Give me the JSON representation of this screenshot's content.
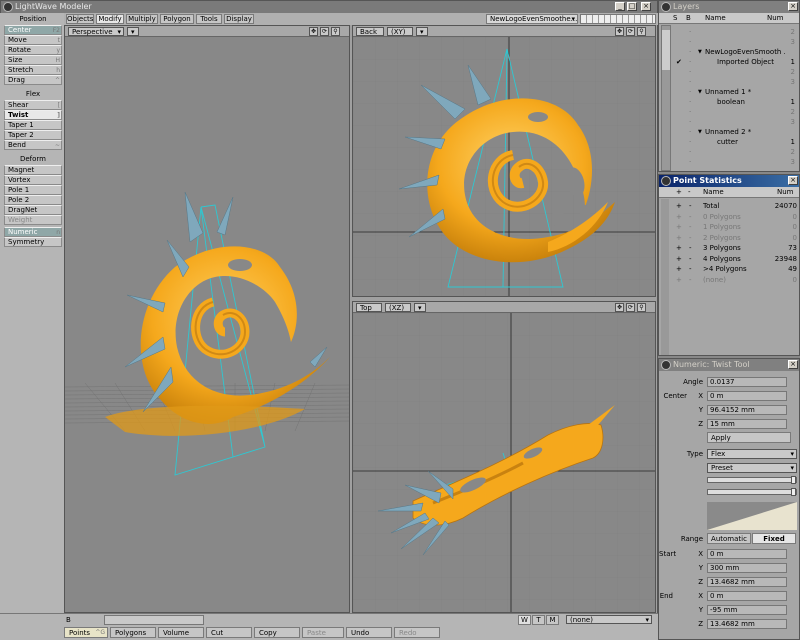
{
  "app": {
    "title": "LightWave Modeler"
  },
  "tabs": [
    "Objects",
    "Modify",
    "Multiply",
    "Polygon",
    "Tools",
    "Display"
  ],
  "object_dropdown": "NewLogoEvenSmoothe...",
  "left": {
    "position_header": "Position",
    "position_items": [
      {
        "label": "Center",
        "key": "F2"
      },
      {
        "label": "Move",
        "key": "t"
      },
      {
        "label": "Rotate",
        "key": "y"
      },
      {
        "label": "Size",
        "key": "H"
      },
      {
        "label": "Stretch",
        "key": "h"
      },
      {
        "label": "Drag",
        "key": "^"
      }
    ],
    "flex_header": "Flex",
    "flex_items": [
      {
        "label": "Shear",
        "key": "["
      },
      {
        "label": "Twist",
        "key": "]"
      },
      {
        "label": "Taper 1",
        "key": ""
      },
      {
        "label": "Taper 2",
        "key": ""
      },
      {
        "label": "Bend",
        "key": "~"
      }
    ],
    "deform_header": "Deform",
    "deform_items": [
      {
        "label": "Magnet",
        "key": ""
      },
      {
        "label": "Vortex",
        "key": ""
      },
      {
        "label": "Pole 1",
        "key": ""
      },
      {
        "label": "Pole 2",
        "key": ""
      },
      {
        "label": "DragNet",
        "key": ""
      }
    ],
    "weight": "Weight",
    "numeric": {
      "label": "Numeric",
      "key": "n"
    },
    "symmetry": "Symmetry"
  },
  "viewports": {
    "perspective": "Perspective",
    "back": "Back",
    "back_axes": "(XY)",
    "top": "Top",
    "top_axes": "(XZ)"
  },
  "layers": {
    "title": "Layers",
    "cols": [
      "S",
      "B",
      "Name",
      "Num"
    ],
    "rows": [
      {
        "name": "",
        "num": "2",
        "indent": 0
      },
      {
        "name": "",
        "num": "3",
        "indent": 0
      },
      {
        "name": "NewLogoEvenSmooth ...",
        "num": "",
        "indent": 1
      },
      {
        "name": "Imported Object",
        "num": "1",
        "indent": 2,
        "check": "✔"
      },
      {
        "name": "",
        "num": "2",
        "indent": 0
      },
      {
        "name": "",
        "num": "3",
        "indent": 0
      },
      {
        "name": "Unnamed 1 *",
        "num": "",
        "indent": 1
      },
      {
        "name": "boolean",
        "num": "1",
        "indent": 2
      },
      {
        "name": "",
        "num": "2",
        "indent": 0
      },
      {
        "name": "",
        "num": "3",
        "indent": 0
      },
      {
        "name": "Unnamed 2 *",
        "num": "",
        "indent": 1
      },
      {
        "name": "cutter",
        "num": "1",
        "indent": 2
      },
      {
        "name": "",
        "num": "2",
        "indent": 0
      },
      {
        "name": "",
        "num": "3",
        "indent": 0
      }
    ]
  },
  "point_stats": {
    "title": "Point Statistics",
    "cols": [
      "+",
      "-",
      "Name",
      "Num"
    ],
    "rows": [
      {
        "name": "Total",
        "num": "24070",
        "dim": false
      },
      {
        "name": "0 Polygons",
        "num": "0",
        "dim": true
      },
      {
        "name": "1 Polygons",
        "num": "0",
        "dim": true
      },
      {
        "name": "2 Polygons",
        "num": "0",
        "dim": true
      },
      {
        "name": "3 Polygons",
        "num": "73",
        "dim": false
      },
      {
        "name": "4 Polygons",
        "num": "23948",
        "dim": false
      },
      {
        "name": ">4 Polygons",
        "num": "49",
        "dim": false
      },
      {
        "name": "(none)",
        "num": "0",
        "dim": true
      }
    ]
  },
  "numeric": {
    "title": "Numeric: Twist Tool",
    "angle_label": "Angle",
    "angle": "0.0137",
    "center_label": "Center",
    "cx": "0 m",
    "cy": "96.4152 mm",
    "cz": "15 mm",
    "apply": "Apply",
    "type_label": "Type",
    "type": "Flex",
    "preset": "Preset",
    "range_label": "Range",
    "range_auto": "Automatic",
    "range_fixed": "Fixed",
    "start_label": "Start",
    "sx": "0 m",
    "sy": "300 mm",
    "sz": "13.4682 mm",
    "end_label": "End",
    "ex": "0 m",
    "ey": "-95 mm",
    "ez": "13.4682 mm",
    "axis_x": "X",
    "axis_y": "Y",
    "axis_z": "Z"
  },
  "bottom": {
    "b_label": "B",
    "wtm": [
      "W",
      "T",
      "M"
    ],
    "none": "(none)",
    "buttons": [
      {
        "label": "Points",
        "key": "^G"
      },
      {
        "label": "Polygons",
        "key": ""
      },
      {
        "label": "Volume",
        "key": ""
      },
      {
        "label": "Cut",
        "key": ""
      },
      {
        "label": "Copy",
        "key": ""
      },
      {
        "label": "Paste",
        "key": ""
      },
      {
        "label": "Undo",
        "key": ""
      },
      {
        "label": "Redo",
        "key": ""
      }
    ]
  },
  "colors": {
    "model": "#f5a81c",
    "spike": "#7fa8bc",
    "cone": "#2ec8d2",
    "grid": "#7d7d7d",
    "axis": "#222222"
  }
}
